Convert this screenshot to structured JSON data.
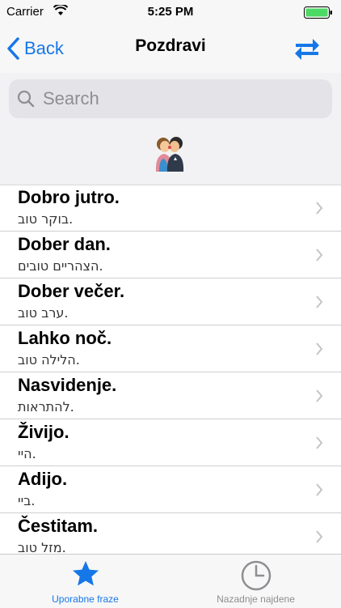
{
  "status_bar": {
    "carrier": "Carrier",
    "time": "5:25 PM"
  },
  "nav": {
    "back_label": "Back",
    "title": "Pozdravi"
  },
  "search": {
    "placeholder": "Search"
  },
  "phrases": [
    {
      "title": "Dobro jutro.",
      "subtitle": "בוקר טוב."
    },
    {
      "title": "Dober dan.",
      "subtitle": "הצהריים טובים."
    },
    {
      "title": "Dober večer.",
      "subtitle": "ערב טוב."
    },
    {
      "title": "Lahko noč.",
      "subtitle": "הלילה טוב."
    },
    {
      "title": "Nasvidenje.",
      "subtitle": "להתראות."
    },
    {
      "title": "Živijo.",
      "subtitle": "היי."
    },
    {
      "title": "Adijo.",
      "subtitle": "ביי."
    },
    {
      "title": "Čestitam.",
      "subtitle": "מזל טוב."
    }
  ],
  "tabs": [
    {
      "label": "Uporabne fraze",
      "icon": "star-icon",
      "active": true
    },
    {
      "label": "Nazadnje najdene",
      "icon": "clock-icon",
      "active": false
    }
  ],
  "colors": {
    "accent": "#1677e8",
    "battery": "#4cd964"
  }
}
